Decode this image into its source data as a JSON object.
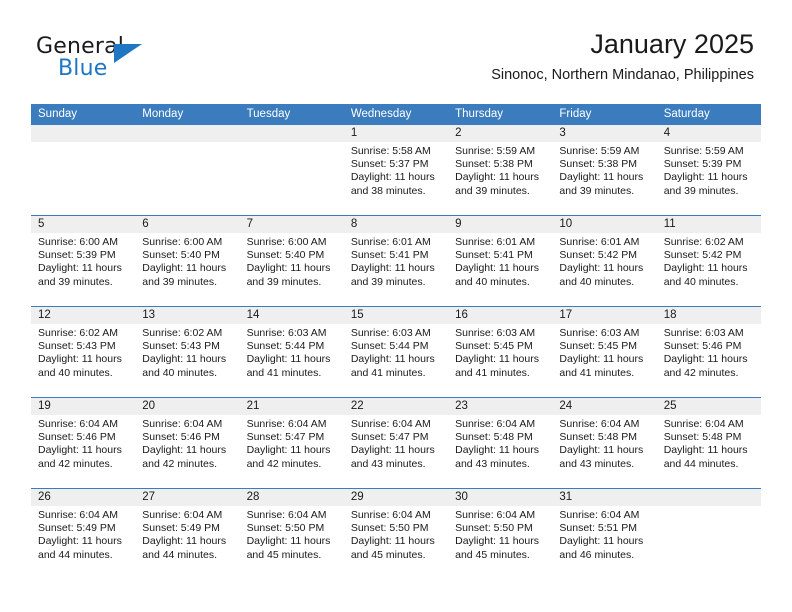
{
  "brand": {
    "line1": "General",
    "line2": "Blue",
    "triangle_icon": "triangle-icon",
    "accent_color": "#1f76c2"
  },
  "header": {
    "title": "January 2025",
    "subtitle": "Sinonoc, Northern Mindanao, Philippines"
  },
  "calendar": {
    "header_bg": "#3a7cbe",
    "date_band_bg": "#efefef",
    "weekdays": [
      "Sunday",
      "Monday",
      "Tuesday",
      "Wednesday",
      "Thursday",
      "Friday",
      "Saturday"
    ],
    "weeks": [
      [
        {
          "day": "",
          "sunrise": "",
          "sunset": "",
          "daylight1": "",
          "daylight2": ""
        },
        {
          "day": "",
          "sunrise": "",
          "sunset": "",
          "daylight1": "",
          "daylight2": ""
        },
        {
          "day": "",
          "sunrise": "",
          "sunset": "",
          "daylight1": "",
          "daylight2": ""
        },
        {
          "day": "1",
          "sunrise": "Sunrise: 5:58 AM",
          "sunset": "Sunset: 5:37 PM",
          "daylight1": "Daylight: 11 hours",
          "daylight2": "and 38 minutes."
        },
        {
          "day": "2",
          "sunrise": "Sunrise: 5:59 AM",
          "sunset": "Sunset: 5:38 PM",
          "daylight1": "Daylight: 11 hours",
          "daylight2": "and 39 minutes."
        },
        {
          "day": "3",
          "sunrise": "Sunrise: 5:59 AM",
          "sunset": "Sunset: 5:38 PM",
          "daylight1": "Daylight: 11 hours",
          "daylight2": "and 39 minutes."
        },
        {
          "day": "4",
          "sunrise": "Sunrise: 5:59 AM",
          "sunset": "Sunset: 5:39 PM",
          "daylight1": "Daylight: 11 hours",
          "daylight2": "and 39 minutes."
        }
      ],
      [
        {
          "day": "5",
          "sunrise": "Sunrise: 6:00 AM",
          "sunset": "Sunset: 5:39 PM",
          "daylight1": "Daylight: 11 hours",
          "daylight2": "and 39 minutes."
        },
        {
          "day": "6",
          "sunrise": "Sunrise: 6:00 AM",
          "sunset": "Sunset: 5:40 PM",
          "daylight1": "Daylight: 11 hours",
          "daylight2": "and 39 minutes."
        },
        {
          "day": "7",
          "sunrise": "Sunrise: 6:00 AM",
          "sunset": "Sunset: 5:40 PM",
          "daylight1": "Daylight: 11 hours",
          "daylight2": "and 39 minutes."
        },
        {
          "day": "8",
          "sunrise": "Sunrise: 6:01 AM",
          "sunset": "Sunset: 5:41 PM",
          "daylight1": "Daylight: 11 hours",
          "daylight2": "and 39 minutes."
        },
        {
          "day": "9",
          "sunrise": "Sunrise: 6:01 AM",
          "sunset": "Sunset: 5:41 PM",
          "daylight1": "Daylight: 11 hours",
          "daylight2": "and 40 minutes."
        },
        {
          "day": "10",
          "sunrise": "Sunrise: 6:01 AM",
          "sunset": "Sunset: 5:42 PM",
          "daylight1": "Daylight: 11 hours",
          "daylight2": "and 40 minutes."
        },
        {
          "day": "11",
          "sunrise": "Sunrise: 6:02 AM",
          "sunset": "Sunset: 5:42 PM",
          "daylight1": "Daylight: 11 hours",
          "daylight2": "and 40 minutes."
        }
      ],
      [
        {
          "day": "12",
          "sunrise": "Sunrise: 6:02 AM",
          "sunset": "Sunset: 5:43 PM",
          "daylight1": "Daylight: 11 hours",
          "daylight2": "and 40 minutes."
        },
        {
          "day": "13",
          "sunrise": "Sunrise: 6:02 AM",
          "sunset": "Sunset: 5:43 PM",
          "daylight1": "Daylight: 11 hours",
          "daylight2": "and 40 minutes."
        },
        {
          "day": "14",
          "sunrise": "Sunrise: 6:03 AM",
          "sunset": "Sunset: 5:44 PM",
          "daylight1": "Daylight: 11 hours",
          "daylight2": "and 41 minutes."
        },
        {
          "day": "15",
          "sunrise": "Sunrise: 6:03 AM",
          "sunset": "Sunset: 5:44 PM",
          "daylight1": "Daylight: 11 hours",
          "daylight2": "and 41 minutes."
        },
        {
          "day": "16",
          "sunrise": "Sunrise: 6:03 AM",
          "sunset": "Sunset: 5:45 PM",
          "daylight1": "Daylight: 11 hours",
          "daylight2": "and 41 minutes."
        },
        {
          "day": "17",
          "sunrise": "Sunrise: 6:03 AM",
          "sunset": "Sunset: 5:45 PM",
          "daylight1": "Daylight: 11 hours",
          "daylight2": "and 41 minutes."
        },
        {
          "day": "18",
          "sunrise": "Sunrise: 6:03 AM",
          "sunset": "Sunset: 5:46 PM",
          "daylight1": "Daylight: 11 hours",
          "daylight2": "and 42 minutes."
        }
      ],
      [
        {
          "day": "19",
          "sunrise": "Sunrise: 6:04 AM",
          "sunset": "Sunset: 5:46 PM",
          "daylight1": "Daylight: 11 hours",
          "daylight2": "and 42 minutes."
        },
        {
          "day": "20",
          "sunrise": "Sunrise: 6:04 AM",
          "sunset": "Sunset: 5:46 PM",
          "daylight1": "Daylight: 11 hours",
          "daylight2": "and 42 minutes."
        },
        {
          "day": "21",
          "sunrise": "Sunrise: 6:04 AM",
          "sunset": "Sunset: 5:47 PM",
          "daylight1": "Daylight: 11 hours",
          "daylight2": "and 42 minutes."
        },
        {
          "day": "22",
          "sunrise": "Sunrise: 6:04 AM",
          "sunset": "Sunset: 5:47 PM",
          "daylight1": "Daylight: 11 hours",
          "daylight2": "and 43 minutes."
        },
        {
          "day": "23",
          "sunrise": "Sunrise: 6:04 AM",
          "sunset": "Sunset: 5:48 PM",
          "daylight1": "Daylight: 11 hours",
          "daylight2": "and 43 minutes."
        },
        {
          "day": "24",
          "sunrise": "Sunrise: 6:04 AM",
          "sunset": "Sunset: 5:48 PM",
          "daylight1": "Daylight: 11 hours",
          "daylight2": "and 43 minutes."
        },
        {
          "day": "25",
          "sunrise": "Sunrise: 6:04 AM",
          "sunset": "Sunset: 5:48 PM",
          "daylight1": "Daylight: 11 hours",
          "daylight2": "and 44 minutes."
        }
      ],
      [
        {
          "day": "26",
          "sunrise": "Sunrise: 6:04 AM",
          "sunset": "Sunset: 5:49 PM",
          "daylight1": "Daylight: 11 hours",
          "daylight2": "and 44 minutes."
        },
        {
          "day": "27",
          "sunrise": "Sunrise: 6:04 AM",
          "sunset": "Sunset: 5:49 PM",
          "daylight1": "Daylight: 11 hours",
          "daylight2": "and 44 minutes."
        },
        {
          "day": "28",
          "sunrise": "Sunrise: 6:04 AM",
          "sunset": "Sunset: 5:50 PM",
          "daylight1": "Daylight: 11 hours",
          "daylight2": "and 45 minutes."
        },
        {
          "day": "29",
          "sunrise": "Sunrise: 6:04 AM",
          "sunset": "Sunset: 5:50 PM",
          "daylight1": "Daylight: 11 hours",
          "daylight2": "and 45 minutes."
        },
        {
          "day": "30",
          "sunrise": "Sunrise: 6:04 AM",
          "sunset": "Sunset: 5:50 PM",
          "daylight1": "Daylight: 11 hours",
          "daylight2": "and 45 minutes."
        },
        {
          "day": "31",
          "sunrise": "Sunrise: 6:04 AM",
          "sunset": "Sunset: 5:51 PM",
          "daylight1": "Daylight: 11 hours",
          "daylight2": "and 46 minutes."
        },
        {
          "day": "",
          "sunrise": "",
          "sunset": "",
          "daylight1": "",
          "daylight2": ""
        }
      ]
    ]
  }
}
